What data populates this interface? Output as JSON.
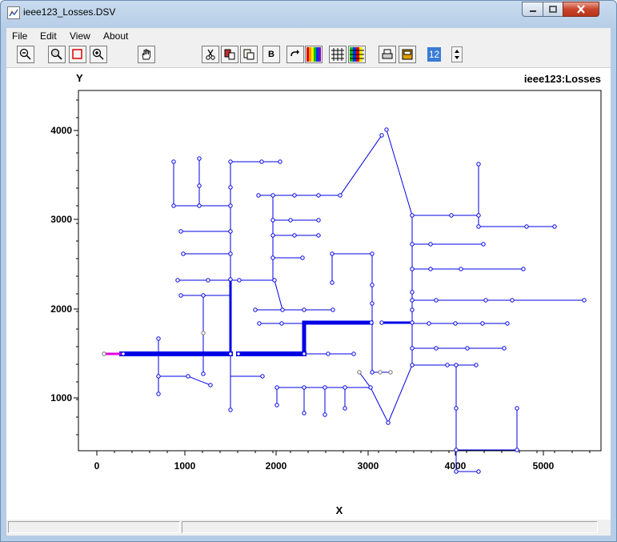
{
  "window": {
    "title": "ieee123_Losses.DSV",
    "caption_buttons": [
      "minimize-icon",
      "maximize-icon",
      "close-icon"
    ]
  },
  "menu": {
    "file": "File",
    "edit": "Edit",
    "view": "View",
    "about": "About"
  },
  "toolbar": {
    "icons": [
      "zoom-out-icon",
      "zoom-icon",
      "zoom-box-icon",
      "zoom-in-icon",
      "pan-hand-icon",
      "cut-icon",
      "copy-icon",
      "paste-icon",
      "label-icon",
      "redraw-icon",
      "color-icon",
      "grid-icon",
      "grid-color-icon",
      "print-icon",
      "print-preview-icon"
    ],
    "label_button": "B",
    "font_size_value": "12"
  },
  "plot": {
    "title": "ieee123:Losses",
    "y_axis_label": "Y",
    "x_axis_label": "X",
    "x_ticks": [
      "0",
      "1000",
      "2000",
      "3000",
      "4000",
      "5000"
    ],
    "y_ticks": [
      "1000",
      "2000",
      "3000",
      "4000"
    ],
    "colors": {
      "feeder": "#0000e6",
      "source": "#e000e0",
      "node": "#0000e6",
      "dim_node": "#707070"
    }
  },
  "status": {
    "pane1": "",
    "pane2": ""
  }
}
